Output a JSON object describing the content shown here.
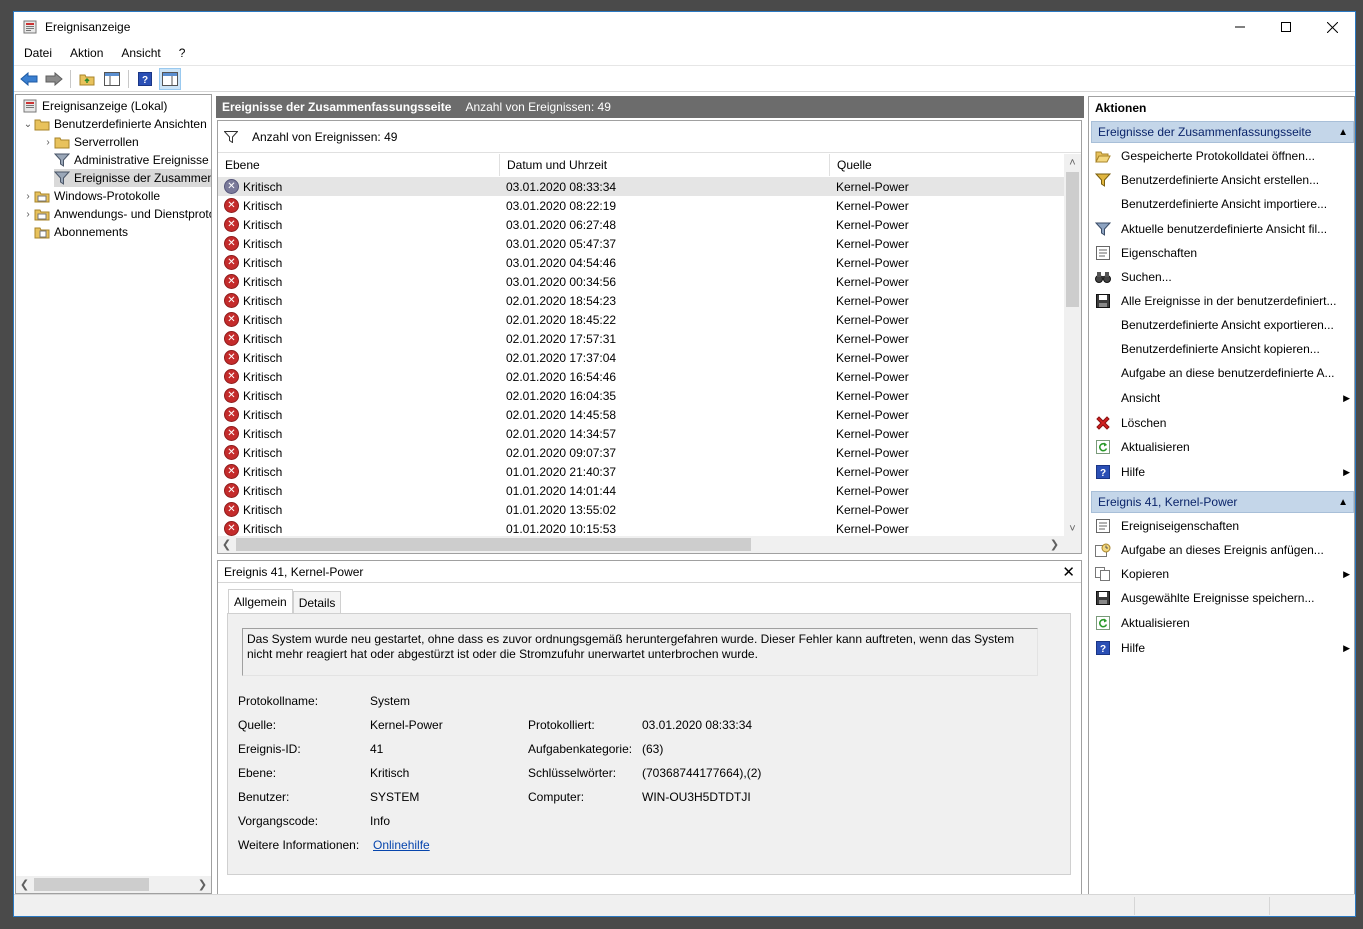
{
  "window": {
    "title": "Ereignisanzeige"
  },
  "menu": [
    "Datei",
    "Aktion",
    "Ansicht",
    "?"
  ],
  "tree": {
    "items": [
      {
        "label": "Ereignisanzeige (Lokal)",
        "level": 0,
        "icon": "event-viewer-icon",
        "chevron": ""
      },
      {
        "label": "Benutzerdefinierte Ansichten",
        "level": 1,
        "icon": "folder-icon",
        "chevron": "down"
      },
      {
        "label": "Serverrollen",
        "level": 2,
        "icon": "folder-icon",
        "chevron": "right"
      },
      {
        "label": "Administrative Ereignisse",
        "level": 2,
        "icon": "filter-icon",
        "chevron": ""
      },
      {
        "label": "Ereignisse der Zusammenfassungsseite",
        "level": 2,
        "icon": "filter-icon",
        "chevron": "",
        "selected": true
      },
      {
        "label": "Windows-Protokolle",
        "level": 1,
        "icon": "folder-icon",
        "chevron": "right"
      },
      {
        "label": "Anwendungs- und Dienstprotokolle",
        "level": 1,
        "icon": "folder-icon",
        "chevron": "right"
      },
      {
        "label": "Abonnements",
        "level": 1,
        "icon": "subscription-icon",
        "chevron": ""
      }
    ]
  },
  "summary": {
    "title": "Ereignisse der Zusammenfassungsseite",
    "count_label": "Anzahl von Ereignissen: 49",
    "filter_label": "Anzahl von Ereignissen: 49"
  },
  "table": {
    "columns": [
      "Ebene",
      "Datum und Uhrzeit",
      "Quelle"
    ],
    "rows": [
      {
        "level": "Kritisch",
        "date": "03.01.2020 08:33:34",
        "source": "Kernel-Power",
        "selected": true
      },
      {
        "level": "Kritisch",
        "date": "03.01.2020 08:22:19",
        "source": "Kernel-Power"
      },
      {
        "level": "Kritisch",
        "date": "03.01.2020 06:27:48",
        "source": "Kernel-Power"
      },
      {
        "level": "Kritisch",
        "date": "03.01.2020 05:47:37",
        "source": "Kernel-Power"
      },
      {
        "level": "Kritisch",
        "date": "03.01.2020 04:54:46",
        "source": "Kernel-Power"
      },
      {
        "level": "Kritisch",
        "date": "03.01.2020 00:34:56",
        "source": "Kernel-Power"
      },
      {
        "level": "Kritisch",
        "date": "02.01.2020 18:54:23",
        "source": "Kernel-Power"
      },
      {
        "level": "Kritisch",
        "date": "02.01.2020 18:45:22",
        "source": "Kernel-Power"
      },
      {
        "level": "Kritisch",
        "date": "02.01.2020 17:57:31",
        "source": "Kernel-Power"
      },
      {
        "level": "Kritisch",
        "date": "02.01.2020 17:37:04",
        "source": "Kernel-Power"
      },
      {
        "level": "Kritisch",
        "date": "02.01.2020 16:54:46",
        "source": "Kernel-Power"
      },
      {
        "level": "Kritisch",
        "date": "02.01.2020 16:04:35",
        "source": "Kernel-Power"
      },
      {
        "level": "Kritisch",
        "date": "02.01.2020 14:45:58",
        "source": "Kernel-Power"
      },
      {
        "level": "Kritisch",
        "date": "02.01.2020 14:34:57",
        "source": "Kernel-Power"
      },
      {
        "level": "Kritisch",
        "date": "02.01.2020 09:07:37",
        "source": "Kernel-Power"
      },
      {
        "level": "Kritisch",
        "date": "01.01.2020 21:40:37",
        "source": "Kernel-Power"
      },
      {
        "level": "Kritisch",
        "date": "01.01.2020 14:01:44",
        "source": "Kernel-Power"
      },
      {
        "level": "Kritisch",
        "date": "01.01.2020 13:55:02",
        "source": "Kernel-Power"
      },
      {
        "level": "Kritisch",
        "date": "01.01.2020 10:15:53",
        "source": "Kernel-Power"
      }
    ]
  },
  "detail": {
    "title": "Ereignis 41, Kernel-Power",
    "tabs": [
      "Allgemein",
      "Details"
    ],
    "message": "Das System wurde neu gestartet, ohne dass es zuvor ordnungsgemäß heruntergefahren wurde. Dieser Fehler kann auftreten, wenn das System nicht mehr reagiert hat oder abgestürzt ist oder die Stromzufuhr unerwartet unterbrochen wurde.",
    "fields": {
      "protokollname_label": "Protokollname:",
      "protokollname": "System",
      "quelle_label": "Quelle:",
      "quelle": "Kernel-Power",
      "protokolliert_label": "Protokolliert:",
      "protokolliert": "03.01.2020 08:33:34",
      "id_label": "Ereignis-ID:",
      "id": "41",
      "kategorie_label": "Aufgabenkategorie:",
      "kategorie": "(63)",
      "ebene_label": "Ebene:",
      "ebene": "Kritisch",
      "schluessel_label": "Schlüsselwörter:",
      "schluessel": "(70368744177664),(2)",
      "benutzer_label": "Benutzer:",
      "benutzer": "SYSTEM",
      "computer_label": "Computer:",
      "computer": "WIN-OU3H5DTDTJI",
      "vorgang_label": "Vorgangscode:",
      "vorgang": "Info",
      "info_label": "Weitere Informationen:",
      "info_link": "Onlinehilfe"
    }
  },
  "actions": {
    "title": "Aktionen",
    "section1": "Ereignisse der Zusammenfassungsseite",
    "items1": [
      {
        "label": "Gespeicherte Protokolldatei öffnen...",
        "icon": "open-folder-icon"
      },
      {
        "label": "Benutzerdefinierte Ansicht erstellen...",
        "icon": "filter-create-icon"
      },
      {
        "label": "Benutzerdefinierte Ansicht importiere...",
        "icon": ""
      },
      {
        "label": "Aktuelle benutzerdefinierte Ansicht fil...",
        "icon": "filter-icon"
      },
      {
        "label": "Eigenschaften",
        "icon": "properties-icon"
      },
      {
        "label": "Suchen...",
        "icon": "binoculars-icon"
      },
      {
        "label": "Alle Ereignisse in der benutzerdefiniert...",
        "icon": "save-icon"
      },
      {
        "label": "Benutzerdefinierte Ansicht exportieren...",
        "icon": ""
      },
      {
        "label": "Benutzerdefinierte Ansicht kopieren...",
        "icon": ""
      },
      {
        "label": "Aufgabe an diese benutzerdefinierte A...",
        "icon": ""
      },
      {
        "label": "Ansicht",
        "icon": "",
        "submenu": true
      },
      {
        "label": "Löschen",
        "icon": "delete-icon"
      },
      {
        "label": "Aktualisieren",
        "icon": "refresh-icon"
      },
      {
        "label": "Hilfe",
        "icon": "help-icon",
        "submenu": true
      }
    ],
    "section2": "Ereignis 41, Kernel-Power",
    "items2": [
      {
        "label": "Ereigniseigenschaften",
        "icon": "properties-icon"
      },
      {
        "label": "Aufgabe an dieses Ereignis anfügen...",
        "icon": "task-icon"
      },
      {
        "label": "Kopieren",
        "icon": "copy-icon",
        "submenu": true
      },
      {
        "label": "Ausgewählte Ereignisse speichern...",
        "icon": "save-icon"
      },
      {
        "label": "Aktualisieren",
        "icon": "refresh-icon"
      },
      {
        "label": "Hilfe",
        "icon": "help-icon",
        "submenu": true
      }
    ]
  }
}
